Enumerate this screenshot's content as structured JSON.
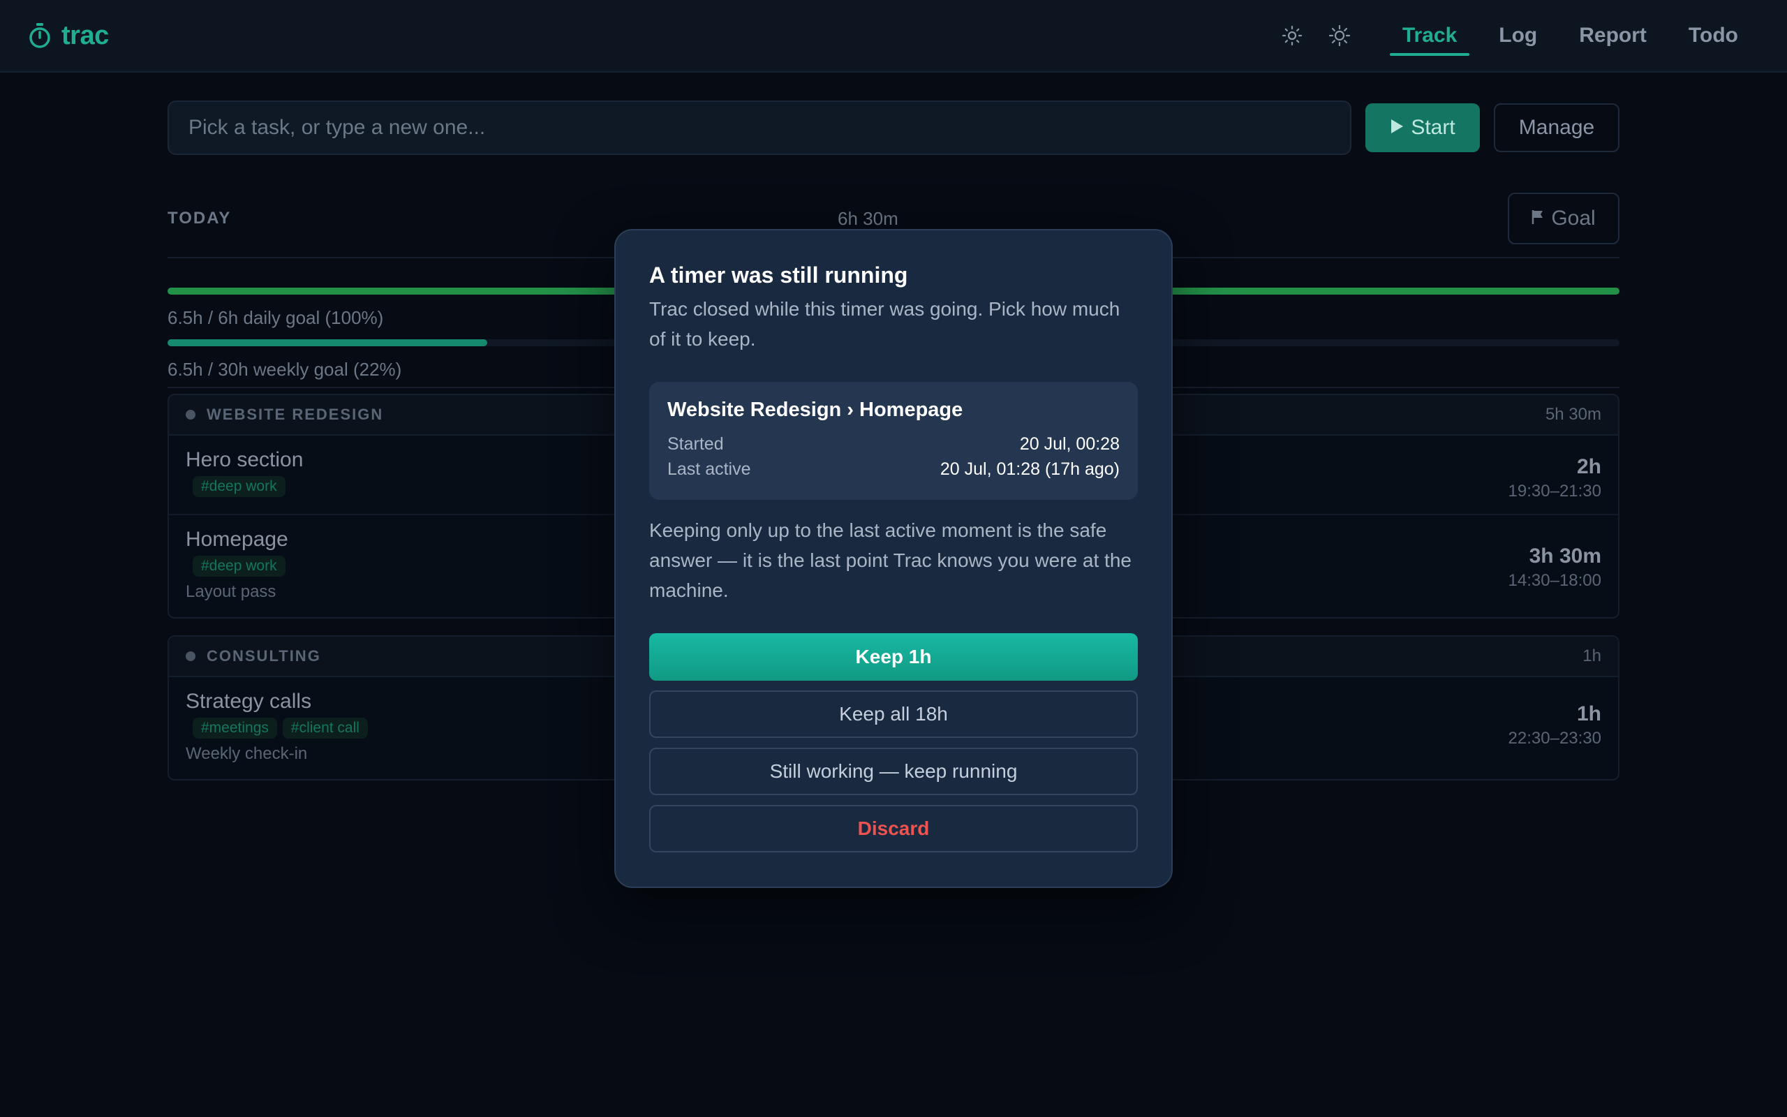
{
  "header": {
    "brand": "trac",
    "nav": [
      {
        "label": "Track",
        "active": true
      },
      {
        "label": "Log",
        "active": false
      },
      {
        "label": "Report",
        "active": false
      },
      {
        "label": "Todo",
        "active": false
      }
    ]
  },
  "task": {
    "placeholder": "Pick a task, or type a new one...",
    "start_label": "Start",
    "manage_label": "Manage"
  },
  "today": {
    "label": "TODAY",
    "total": "6h 30m",
    "goal_label": "Goal",
    "daily_goal_text": "6.5h / 6h daily goal (100%)",
    "daily_goal_percent": 100,
    "weekly_goal_text": "6.5h / 30h weekly goal (22%)",
    "weekly_goal_percent": 22
  },
  "projects": [
    {
      "name": "WEBSITE REDESIGN",
      "total": "5h 30m",
      "entries": [
        {
          "name": "Hero section",
          "tags": [
            "#deep work"
          ],
          "note": "",
          "duration": "2h",
          "range": "19:30–21:30"
        },
        {
          "name": "Homepage",
          "tags": [
            "#deep work"
          ],
          "note": "Layout pass",
          "duration": "3h 30m",
          "range": "14:30–18:00"
        }
      ]
    },
    {
      "name": "CONSULTING",
      "total": "1h",
      "entries": [
        {
          "name": "Strategy calls",
          "tags": [
            "#meetings",
            "#client call"
          ],
          "note": "Weekly check-in",
          "duration": "1h",
          "range": "22:30–23:30"
        }
      ]
    }
  ],
  "modal": {
    "title": "A timer was still running",
    "description": "Trac closed while this timer was going. Pick how much of it to keep.",
    "task_path": "Website Redesign › Homepage",
    "started_label": "Started",
    "started_value": "20 Jul, 00:28",
    "last_active_label": "Last active",
    "last_active_value": "20 Jul, 01:28 (17h ago)",
    "note": "Keeping only up to the last active moment is the safe answer — it is the last point Trac knows you were at the machine.",
    "keep_short_label": "Keep 1h",
    "keep_all_label": "Keep all 18h",
    "keep_running_label": "Still working — keep running",
    "discard_label": "Discard"
  },
  "colors": {
    "accent": "#1fae92",
    "primary_button": "#18b8a2",
    "danger": "#ef5350",
    "modal_bg": "#182940",
    "daily_bar": "#239048",
    "weekly_bar": "#168a6e"
  },
  "icons": {
    "brand": "stopwatch-icon",
    "theme_light": "sun-icon",
    "theme_auto": "sun-icon",
    "start": "play-icon",
    "goal": "flag-icon"
  }
}
